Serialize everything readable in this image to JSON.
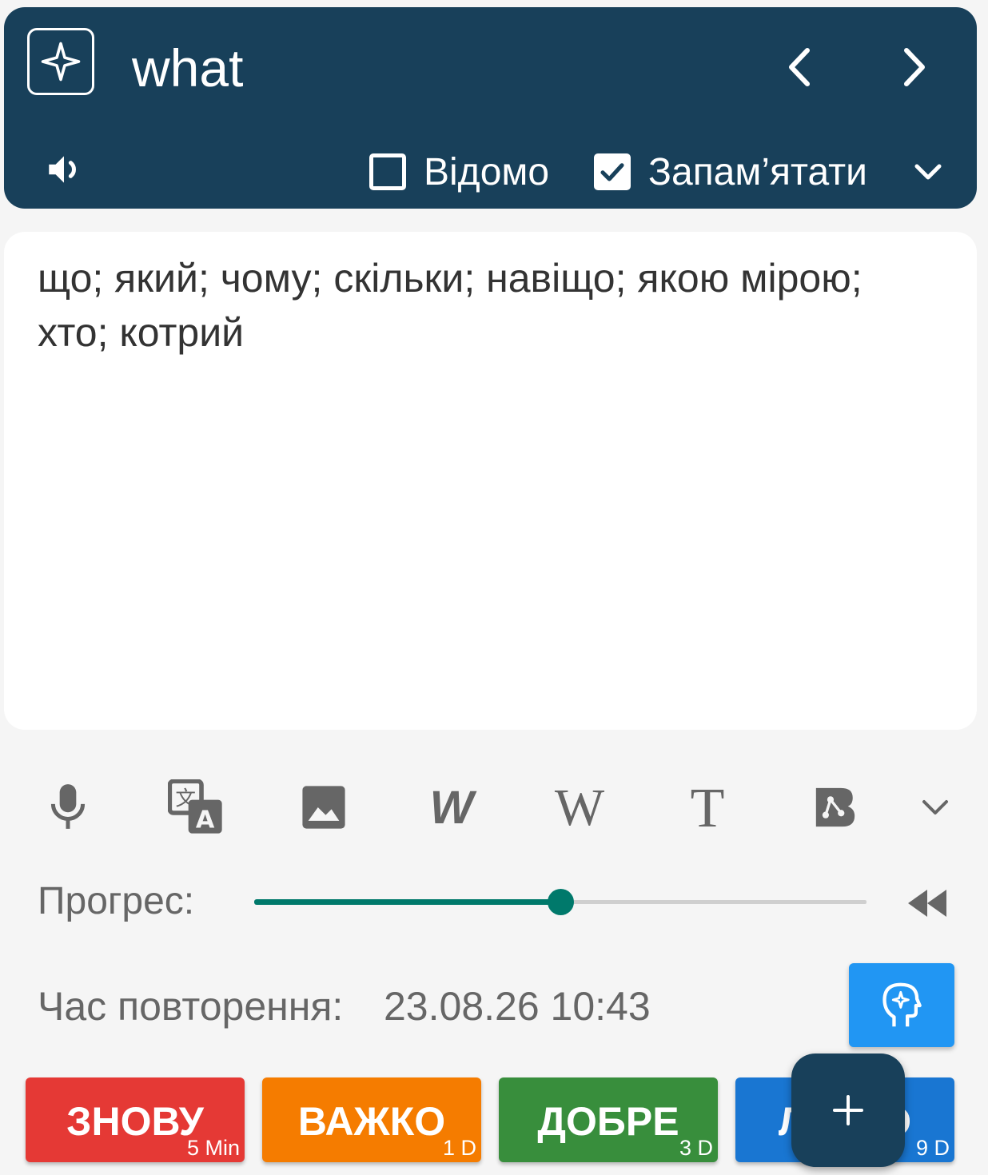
{
  "header": {
    "word": "what",
    "known_label": "Відомо",
    "known_checked": false,
    "remember_label": "Запам’ятати",
    "remember_checked": true
  },
  "translation": "що; який; чому; скільки; навіщо; якою мірою; хто; котрий",
  "toolbar": [
    "microphone-icon",
    "translate-icon",
    "image-icon",
    "wordreference-icon",
    "wikipedia-icon",
    "text-icon",
    "brainly-icon",
    "chevron-down-icon"
  ],
  "progress": {
    "label": "Прогрес:",
    "value": 0.5
  },
  "review": {
    "label": "Час повторення:",
    "value": "23.08.26 10:43"
  },
  "grades": [
    {
      "label": "ЗНОВУ",
      "interval": "5 Min",
      "color": "#e53935"
    },
    {
      "label": "ВАЖКО",
      "interval": "1 D",
      "color": "#f57c00"
    },
    {
      "label": "ДОБРЕ",
      "interval": "3 D",
      "color": "#388e3c"
    },
    {
      "label": "ЛЕГКО",
      "interval": "9 D",
      "color": "#1976d2"
    }
  ],
  "colors": {
    "header": "#18405a",
    "accent": "#00796b",
    "brain_button": "#2196f3"
  }
}
